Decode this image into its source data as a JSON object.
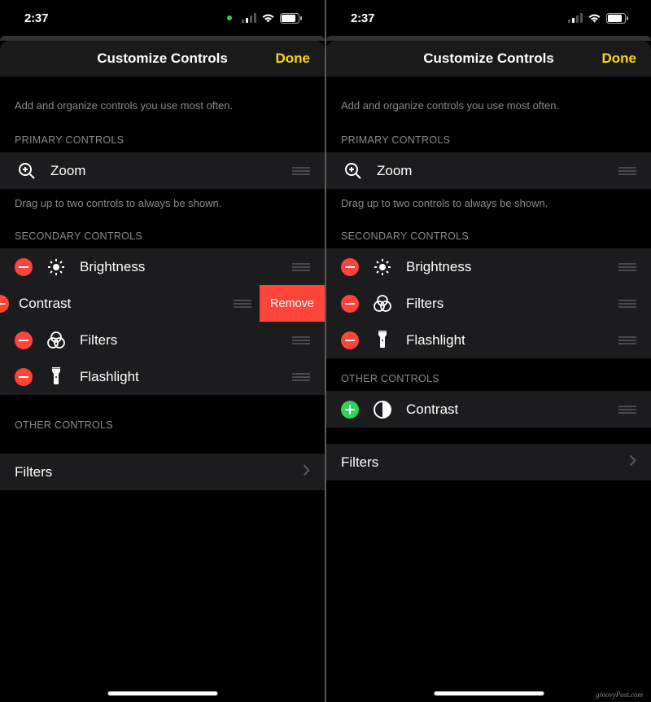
{
  "statusBar": {
    "time": "2:37"
  },
  "header": {
    "title": "Customize Controls",
    "done": "Done"
  },
  "description": "Add and organize controls you use most often.",
  "sections": {
    "primaryHeader": "PRIMARY CONTROLS",
    "primaryFooter": "Drag up to two controls to always be shown.",
    "secondaryHeader": "SECONDARY CONTROLS",
    "otherHeader": "OTHER CONTROLS"
  },
  "controls": {
    "zoom": "Zoom",
    "brightness": "Brightness",
    "contrast": "Contrast",
    "filters": "Filters",
    "flashlight": "Flashlight"
  },
  "removeLabel": "Remove",
  "filtersLink": "Filters",
  "watermark": "groovyPost.com"
}
